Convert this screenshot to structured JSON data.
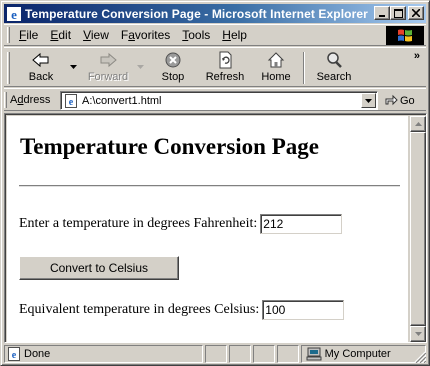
{
  "window": {
    "title": "Temperature Conversion Page - Microsoft Internet Explorer"
  },
  "menu": {
    "items": [
      {
        "label": "File",
        "accel": "F",
        "rest": "ile"
      },
      {
        "label": "Edit",
        "accel": "E",
        "rest": "dit"
      },
      {
        "label": "View",
        "accel": "V",
        "rest": "iew"
      },
      {
        "label": "Favorites",
        "accel": "a",
        "pre": "F",
        "rest": "vorites"
      },
      {
        "label": "Tools",
        "accel": "T",
        "rest": "ools"
      },
      {
        "label": "Help",
        "accel": "H",
        "rest": "elp"
      }
    ]
  },
  "toolbar": {
    "back": "Back",
    "forward": "Forward",
    "stop": "Stop",
    "refresh": "Refresh",
    "home": "Home",
    "search": "Search",
    "more": "»"
  },
  "address": {
    "label_accel": "d",
    "label_pre": "A",
    "label_rest": "dress",
    "value": "A:\\convert1.html",
    "go": "Go"
  },
  "page": {
    "heading": "Temperature Conversion Page",
    "fahrenheit_label": "Enter a temperature in degrees Fahrenheit:",
    "fahrenheit_value": "212",
    "convert_button": "Convert to Celsius",
    "celsius_label": "Equivalent temperature in degrees Celsius:",
    "celsius_value": "100"
  },
  "status": {
    "text": "Done",
    "zone": "My Computer"
  }
}
